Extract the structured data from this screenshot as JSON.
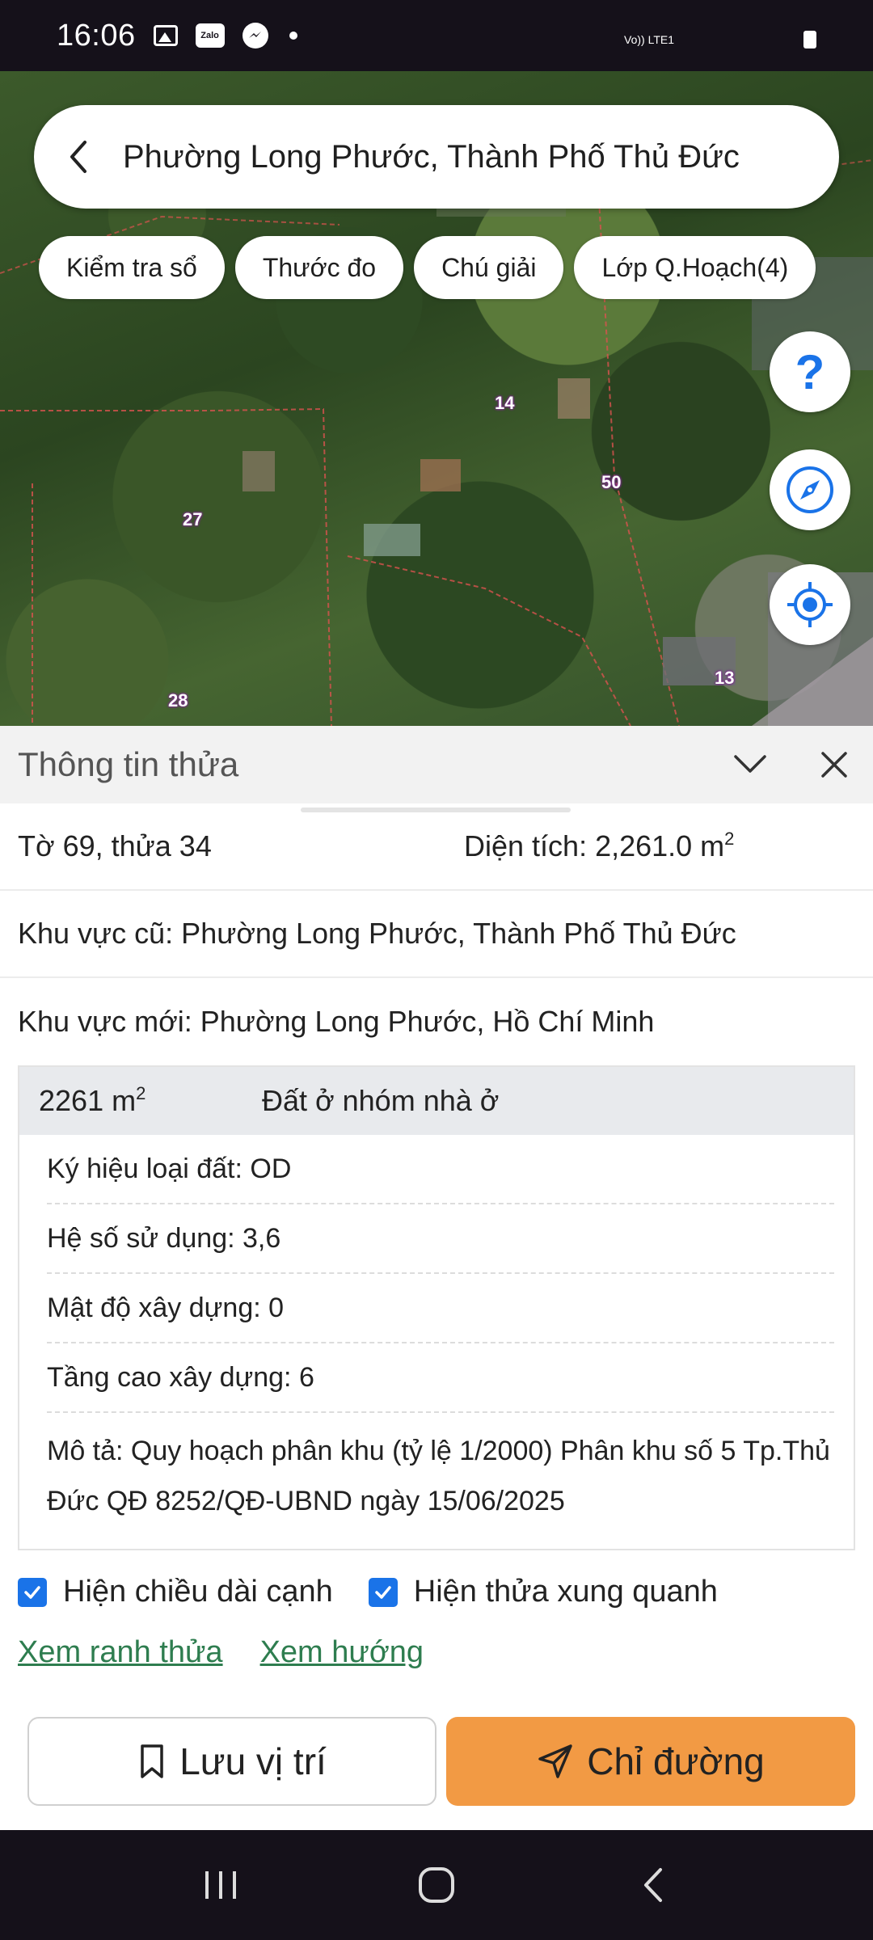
{
  "status_bar": {
    "time": "16:06",
    "network": "Vo)) LTE1",
    "notification_icons": [
      "gallery-icon",
      "zalo-icon",
      "messenger-icon",
      "dot-icon"
    ],
    "zalo_label": "Zalo"
  },
  "search": {
    "title": "Phường Long Phước, Thành Phố Thủ Đức"
  },
  "chips": [
    {
      "label": "Kiểm tra sổ"
    },
    {
      "label": "Thước đo"
    },
    {
      "label": "Chú giải"
    },
    {
      "label": "Lớp Q.Hoạch(4)"
    }
  ],
  "map": {
    "parcel_labels": [
      "14",
      "50",
      "27",
      "13",
      "28"
    ],
    "fab_icons": [
      "help-icon",
      "compass-icon",
      "my-location-icon"
    ],
    "help_glyph": "?"
  },
  "panel": {
    "title": "Thông tin thửa",
    "sheet_parcel": "Tờ 69, thửa 34",
    "area_label": "Diện tích: 2,261.0 m",
    "area_sup": "2",
    "old_area": "Khu vực cũ: Phường Long Phước, Thành Phố Thủ Đức",
    "new_area": "Khu vực mới: Phường Long Phước, Hồ Chí Minh",
    "zone": {
      "area": "2261 m",
      "area_sup": "2",
      "type": "Đất ở nhóm nhà ở",
      "land_code": "Ký hiệu loại đất: OD",
      "use_ratio": "Hệ số sử dụng: 3,6",
      "density": "Mật độ xây dựng: 0",
      "height": "Tầng cao xây dựng: 6",
      "description": "Mô tả: Quy hoạch phân khu (tỷ lệ 1/2000) Phân khu số 5 Tp.Thủ Đức QĐ 8252/QĐ-UBND ngày 15/06/2025"
    },
    "checkboxes": [
      {
        "label": "Hiện chiều dài cạnh",
        "checked": true
      },
      {
        "label": "Hiện thửa xung quanh",
        "checked": true
      }
    ],
    "links": [
      "Xem ranh thửa",
      "Xem hướng"
    ],
    "buttons": {
      "save": "Lưu vị trí",
      "directions": "Chỉ đường"
    }
  },
  "colors": {
    "accent_orange": "#f29a44",
    "link_green": "#2e7d4f",
    "checkbox_blue": "#1a73e8",
    "fab_blue": "#1a73e8"
  }
}
